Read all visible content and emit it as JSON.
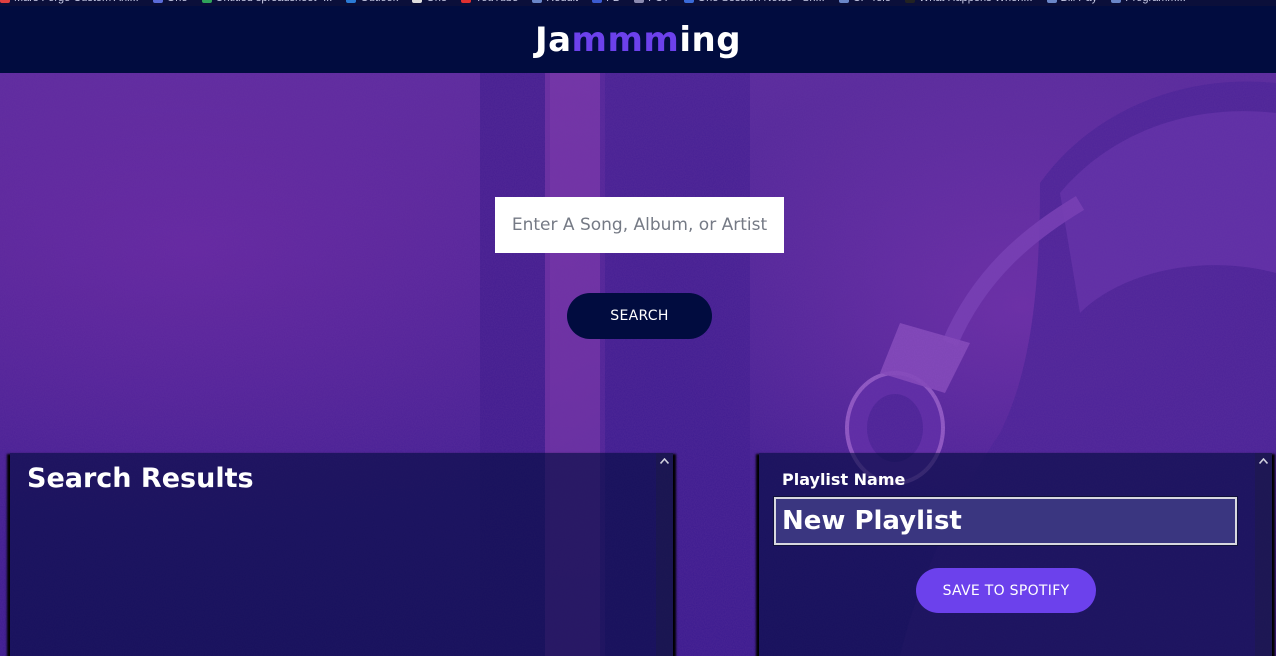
{
  "bookmarks": [
    {
      "label": "Mars Forge Custom Ani..."
    },
    {
      "label": "One"
    },
    {
      "label": "Untitled spreadsheet -..."
    },
    {
      "label": "Outlook"
    },
    {
      "label": "One"
    },
    {
      "label": "YouTube"
    },
    {
      "label": "Reddit"
    },
    {
      "label": "FB"
    },
    {
      "label": "FCT"
    },
    {
      "label": "One Session Notes - Sh..."
    },
    {
      "label": "CP Tele"
    },
    {
      "label": "What Happens When..."
    },
    {
      "label": "Bill Pay"
    },
    {
      "label": "Programm..."
    }
  ],
  "header": {
    "logo_start": "Ja",
    "logo_accent": "mmm",
    "logo_end": "ing"
  },
  "search": {
    "placeholder": "Enter A Song, Album, or Artist",
    "value": "",
    "button_label": "SEARCH"
  },
  "results": {
    "title": "Search Results",
    "scroll_arrow_icon": "chevron-up-icon"
  },
  "playlist": {
    "label": "Playlist Name",
    "name_value": "New Playlist",
    "save_label": "SAVE TO SPOTIFY",
    "scroll_arrow_icon": "chevron-up-icon"
  },
  "colors": {
    "header_bg": "#010c3f",
    "accent": "#6c41ec",
    "button_dark": "#010c3f"
  }
}
